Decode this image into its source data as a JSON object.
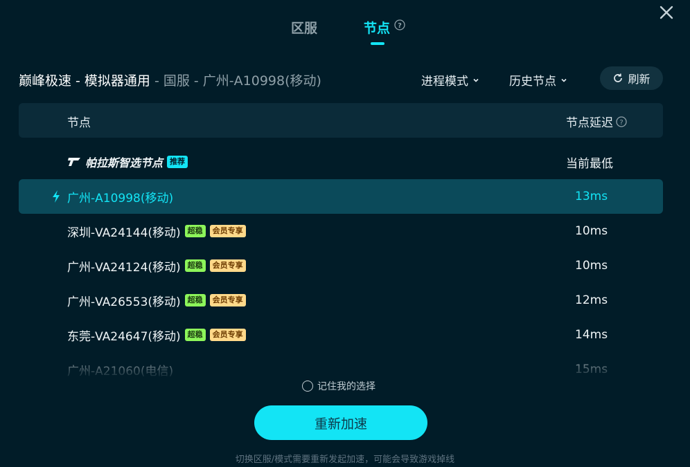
{
  "tabs": {
    "region": "区服",
    "node": "节点"
  },
  "header": {
    "title_strong": "巅峰极速 - 模拟器通用",
    "title_muted": " - 国服 - 广州-A10998(移动)",
    "mode_label": "进程模式",
    "history_label": "历史节点",
    "refresh_label": "刷新"
  },
  "table": {
    "col_node": "节点",
    "col_latency": "节点延迟"
  },
  "smart_row": {
    "name": "帕拉斯智选节点",
    "badge": "推荐",
    "latency": "当前最低"
  },
  "rows": [
    {
      "name": "广州-A10998(移动)",
      "latency": "13ms",
      "selected": true
    },
    {
      "name": "深圳-VA24144(移动)",
      "badge1": "超稳",
      "badge2": "会员专享",
      "latency": "10ms"
    },
    {
      "name": "广州-VA24124(移动)",
      "badge1": "超稳",
      "badge2": "会员专享",
      "latency": "10ms"
    },
    {
      "name": "广州-VA26553(移动)",
      "badge1": "超稳",
      "badge2": "会员专享",
      "latency": "12ms"
    },
    {
      "name": "东莞-VA24647(移动)",
      "badge1": "超稳",
      "badge2": "会员专享",
      "latency": "14ms"
    },
    {
      "name": "广州-A21060(电信)",
      "latency": "15ms"
    }
  ],
  "remember_label": "记住我的选择",
  "accelerate_label": "重新加速",
  "footer_note": "切换区服/模式需要重新发起加速，可能会导致游戏掉线",
  "colors": {
    "accent": "#13e4f5",
    "background": "#011c28",
    "selected_row": "#0b4a5a"
  }
}
